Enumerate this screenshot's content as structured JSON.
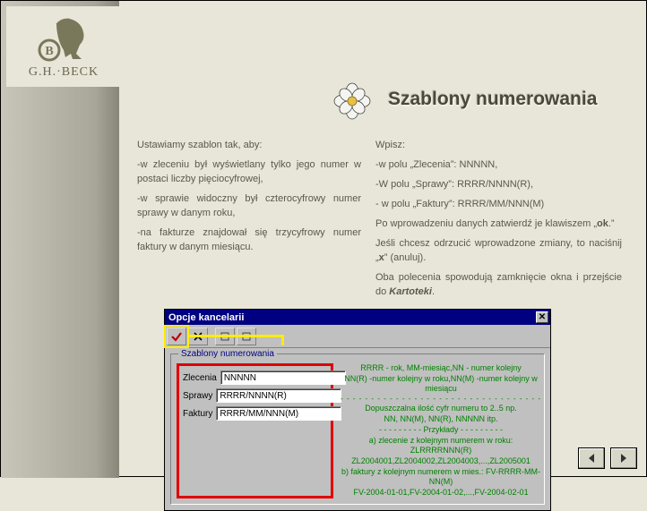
{
  "brand": {
    "name": "G.H.·BECK"
  },
  "page": {
    "title": "Szablony numerowania"
  },
  "left_col": {
    "intro": "Ustawiamy szablon tak, aby:",
    "p1": "-w zleceniu był wyświetlany tylko jego numer w postaci liczby pięciocyfrowej,",
    "p2": "-w sprawie widoczny był czterocyfrowy numer sprawy w danym roku,",
    "p3": "-na fakturze znajdował się trzycyfrowy numer faktury w danym miesiącu."
  },
  "right_col": {
    "intro": "Wpisz:",
    "p1": "-w polu „Zlecenia”: NNNNN,",
    "p2": "-W polu „Sprawy”: RRRR/NNNN(R),",
    "p3": "- w polu „Faktury”: RRRR/MM/NNN(M)",
    "p4a": "Po wprowadzeniu danych zatwierdź je klawiszem „",
    "p4b": "ok",
    "p4c": ".”",
    "p5a": "Jeśli chcesz odrzucić wprowadzone zmiany, to naciśnij „",
    "p5b": "x",
    "p5c": "” (anuluj).",
    "p6a": "Oba polecenia spowodują zamknięcie okna i przejście do ",
    "p6b": "Kartoteki",
    "p6c": "."
  },
  "dialog": {
    "title": "Opcje kancelarii",
    "group_label": "Szablony numerowania",
    "fields": {
      "zlecenia": {
        "label": "Zlecenia",
        "value": "NNNNN"
      },
      "sprawy": {
        "label": "Sprawy",
        "value": "RRRR/NNNN(R)"
      },
      "faktury": {
        "label": "Faktury",
        "value": "RRRR/MM/NNN(M)"
      }
    },
    "info": {
      "l1": "RRRR - rok, MM-miesiąc,NN - numer kolejny",
      "l2": "NN(R) -numer kolejny w roku,NN(M) -numer kolejny w miesiącu",
      "l3": "Dopuszczalna ilość cyfr numeru to 2..5 np.",
      "l4": "NN, NN(M), NN(R), NNNNN itp.",
      "l5": "Przykłady",
      "l6": "a) zlecenie z kolejnym numerem w roku: ZLRRRRNNN(R)",
      "l7": "ZL2004001,ZL2004002,ZL2004003,...,ZL2005001",
      "l8": "b) faktury z kolejnym numerem w mies.: FV-RRRR-MM-NN(M)",
      "l9": "FV-2004-01-01,FV-2004-01-02,...,FV-2004-02-01"
    }
  },
  "icons": {
    "close_glyph": "✕",
    "prev": "◀",
    "next": "▶"
  }
}
